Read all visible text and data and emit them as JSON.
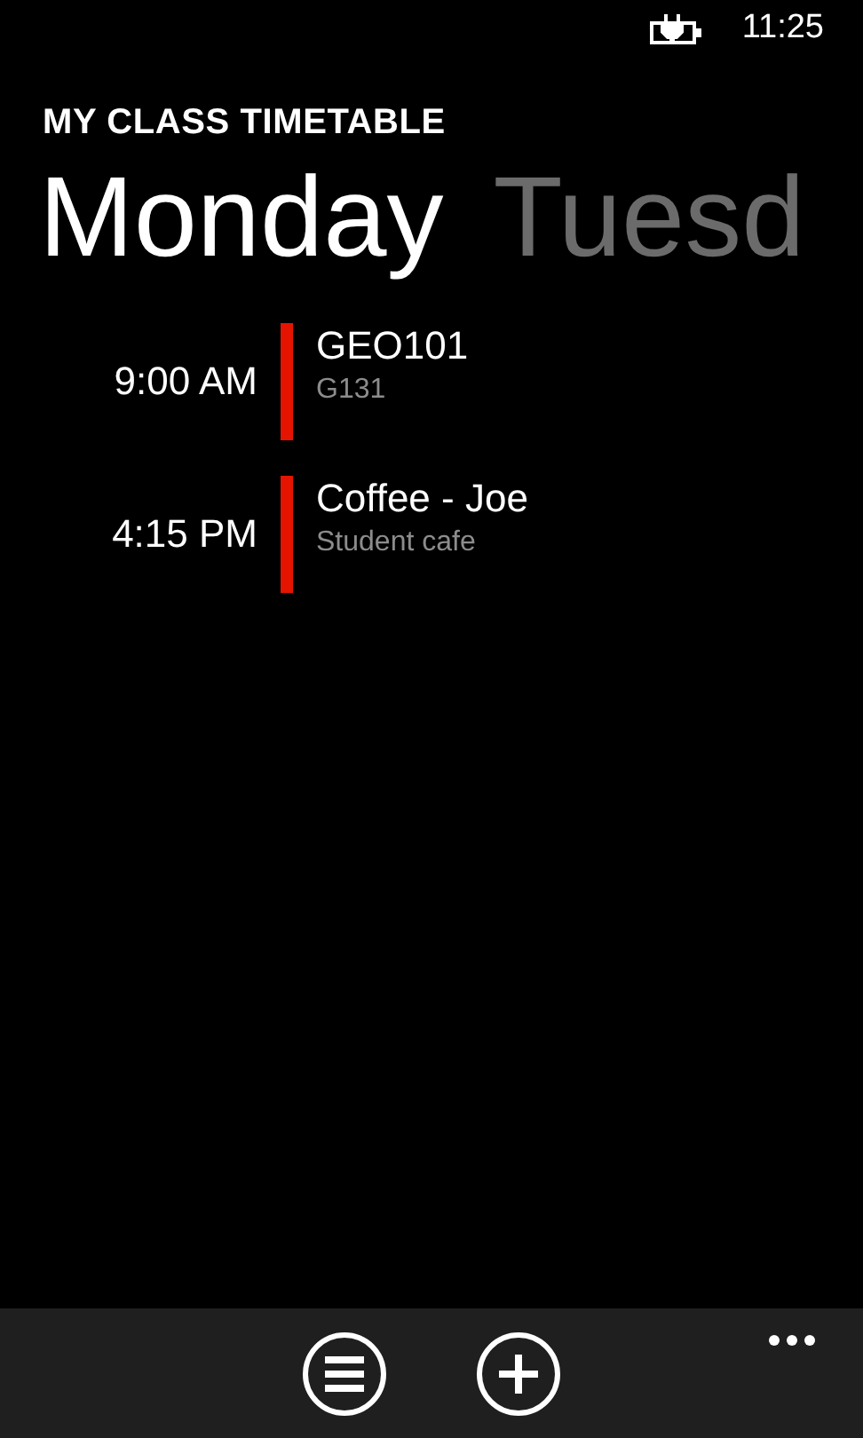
{
  "status_bar": {
    "time": "11:25"
  },
  "app_title": "MY CLASS TIMETABLE",
  "pivot": [
    {
      "label": "Monday",
      "selected": true
    },
    {
      "label": "Tuesd",
      "selected": false
    }
  ],
  "events": [
    {
      "time": "9:00 AM",
      "title": "GEO101",
      "location": "G131",
      "color": "#e51400"
    },
    {
      "time": "4:15 PM",
      "title": "Coffee - Joe",
      "location": "Student cafe",
      "color": "#e51400"
    }
  ],
  "app_bar": {
    "buttons": [
      {
        "kind": "list"
      },
      {
        "kind": "add"
      }
    ]
  }
}
